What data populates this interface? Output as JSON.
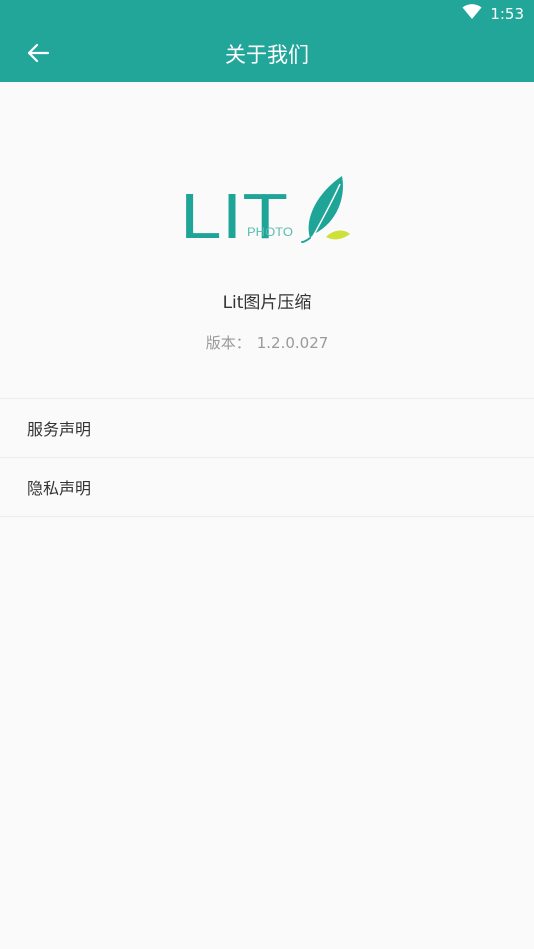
{
  "status_bar": {
    "time": "1:53",
    "icons": [
      "wifi-icon"
    ]
  },
  "header": {
    "back_icon": "arrow-left-icon",
    "title": "关于我们"
  },
  "about": {
    "logo": {
      "wordmark": "LIT",
      "subtext": "PHOTO",
      "icon": "feather-icon"
    },
    "app_name": "Lit图片压缩",
    "version_label": "版本：",
    "version_value": "1.2.0.027"
  },
  "menu": {
    "items": [
      {
        "label": "服务声明"
      },
      {
        "label": "隐私声明"
      }
    ]
  },
  "colors": {
    "primary": "#22a69a",
    "logo_teal": "#1fa597",
    "logo_leaf": "#cfe03a",
    "background": "#fafafa",
    "text": "#333333",
    "secondary_text": "#9a9a9a"
  }
}
